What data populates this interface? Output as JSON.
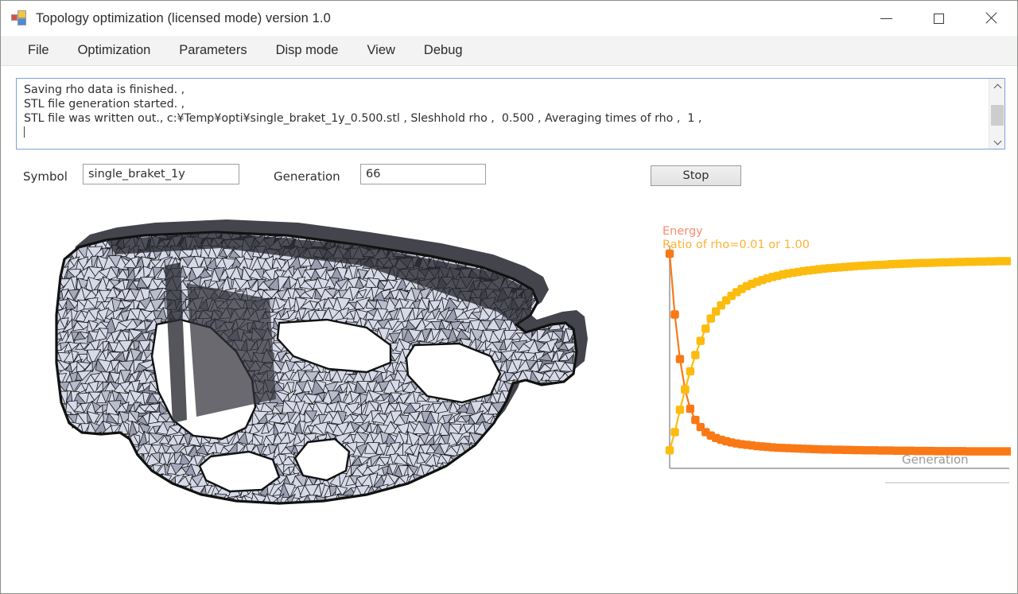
{
  "window": {
    "title": "Topology optimization (licensed mode) version 1.0",
    "icon": "app-grid-icon",
    "minimize_label": "─",
    "maximize_label": "□",
    "close_label": "✕"
  },
  "menubar": {
    "items": [
      {
        "label": "File"
      },
      {
        "label": "Optimization"
      },
      {
        "label": "Parameters"
      },
      {
        "label": "Disp mode"
      },
      {
        "label": "View"
      },
      {
        "label": "Debug"
      }
    ]
  },
  "log": {
    "lines": [
      "Saving rho data is finished. ,",
      "STL file generation started. ,",
      "STL file was written out., c:¥Temp¥opti¥single_braket_1y_0.500.stl , Sleshhold rho ,  0.500 , Averaging times of rho ,  1 ,"
    ],
    "text": "Saving rho data is finished. ,\nSTL file generation started. ,\nSTL file was written out., c:¥Temp¥opti¥single_braket_1y_0.500.stl , Sleshhold rho ,  0.500 , Averaging times of rho ,  1 ,",
    "scrollbar": {
      "up_arrow": "∧",
      "down_arrow": "∨"
    }
  },
  "form": {
    "symbol_label": "Symbol",
    "symbol_value": "single_braket_1y",
    "symbol_placeholder": "",
    "generation_label": "Generation",
    "generation_value": "66",
    "generation_placeholder": "",
    "stop_label": "Stop"
  },
  "mesh": {
    "title": "topology-optimized bracket mesh",
    "fill_color": "#d6d9e8",
    "edge_color": "#111111",
    "shade_color": "#9a9db0"
  },
  "chart_data": {
    "type": "line",
    "title": "",
    "subtitle": "",
    "xlabel": "Generation",
    "ylabel": "",
    "legend_position": "top-left",
    "grid": false,
    "axis_color": "#b0b0b0",
    "xlim": [
      0,
      66
    ],
    "ylim": [
      0,
      1
    ],
    "legend": [
      {
        "name": "Energy",
        "color": "#fa8a6e"
      },
      {
        "name": "Ratio of rho=0.01 or 1.00",
        "color": "#fcb233"
      }
    ],
    "x": [
      0,
      1,
      2,
      3,
      4,
      5,
      6,
      7,
      8,
      9,
      10,
      11,
      12,
      13,
      14,
      15,
      16,
      17,
      18,
      19,
      20,
      21,
      22,
      23,
      24,
      25,
      26,
      27,
      28,
      29,
      30,
      31,
      32,
      33,
      34,
      35,
      36,
      37,
      38,
      39,
      40,
      41,
      42,
      43,
      44,
      45,
      46,
      47,
      48,
      49,
      50,
      51,
      52,
      53,
      54,
      55,
      56,
      57,
      58,
      59,
      60,
      61,
      62,
      63,
      64,
      65,
      66
    ],
    "series": [
      {
        "name": "Energy",
        "color": "#f97916",
        "marker": "square",
        "values": [
          1.0,
          0.7,
          0.48,
          0.33,
          0.235,
          0.18,
          0.145,
          0.12,
          0.103,
          0.091,
          0.082,
          0.075,
          0.069,
          0.064,
          0.06,
          0.057,
          0.054,
          0.051,
          0.049,
          0.047,
          0.045,
          0.043,
          0.042,
          0.041,
          0.04,
          0.039,
          0.038,
          0.037,
          0.036,
          0.035,
          0.034,
          0.034,
          0.033,
          0.033,
          0.032,
          0.032,
          0.031,
          0.031,
          0.03,
          0.03,
          0.03,
          0.029,
          0.029,
          0.029,
          0.028,
          0.028,
          0.028,
          0.028,
          0.027,
          0.027,
          0.027,
          0.027,
          0.026,
          0.026,
          0.026,
          0.026,
          0.026,
          0.026,
          0.025,
          0.025,
          0.025,
          0.025,
          0.025,
          0.025,
          0.025,
          0.025,
          0.025
        ]
      },
      {
        "name": "Ratio of rho=0.01 or 1.00",
        "color": "#fcbc0f",
        "marker": "square",
        "values": [
          0.03,
          0.12,
          0.23,
          0.33,
          0.42,
          0.5,
          0.57,
          0.63,
          0.68,
          0.715,
          0.745,
          0.77,
          0.792,
          0.81,
          0.826,
          0.84,
          0.851,
          0.861,
          0.87,
          0.878,
          0.885,
          0.891,
          0.897,
          0.902,
          0.906,
          0.91,
          0.914,
          0.917,
          0.92,
          0.923,
          0.926,
          0.928,
          0.93,
          0.932,
          0.934,
          0.936,
          0.938,
          0.94,
          0.941,
          0.943,
          0.944,
          0.945,
          0.946,
          0.948,
          0.949,
          0.95,
          0.951,
          0.952,
          0.953,
          0.954,
          0.954,
          0.955,
          0.956,
          0.957,
          0.957,
          0.958,
          0.959,
          0.959,
          0.96,
          0.96,
          0.961,
          0.961,
          0.962,
          0.962,
          0.963,
          0.963,
          0.963
        ]
      }
    ]
  }
}
